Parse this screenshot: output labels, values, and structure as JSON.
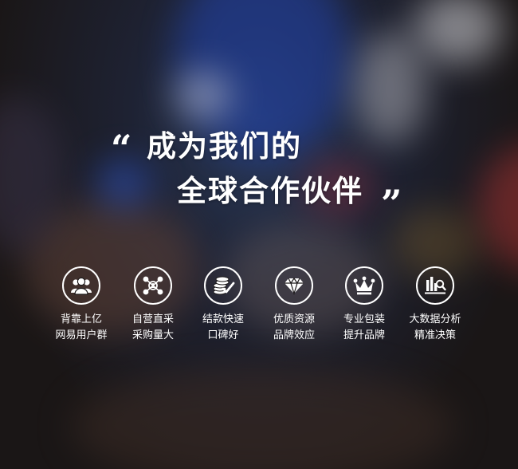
{
  "hero": {
    "quote_open": "“",
    "quote_close": "”",
    "line1": "成为我们的",
    "line2": "全球合作伙伴"
  },
  "features": [
    {
      "icon": "users-icon",
      "line1": "背靠上亿",
      "line2": "网易用户群"
    },
    {
      "icon": "network-icon",
      "line1": "自营直采",
      "line2": "采购量大"
    },
    {
      "icon": "coins-check-icon",
      "line1": "结款快速",
      "line2": "口碑好"
    },
    {
      "icon": "diamond-icon",
      "line1": "优质资源",
      "line2": "品牌效应"
    },
    {
      "icon": "crown-icon",
      "line1": "专业包装",
      "line2": "提升品牌"
    },
    {
      "icon": "chart-search-icon",
      "line1": "大数据分析",
      "line2": "精准决策"
    }
  ]
}
